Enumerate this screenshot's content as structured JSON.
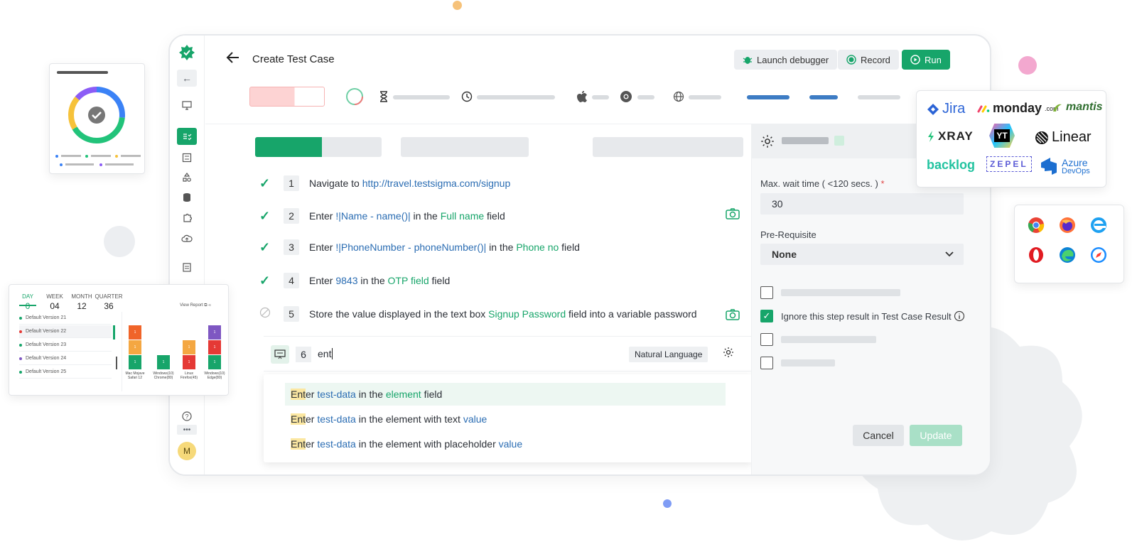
{
  "header": {
    "title": "Create Test Case",
    "launch_debugger": "Launch debugger",
    "record": "Record",
    "run": "Run"
  },
  "steps": [
    {
      "num": "1",
      "parts": [
        {
          "t": "Navigate to ",
          "c": ""
        },
        {
          "t": "http://travel.testsigma.com/signup",
          "c": "blue"
        }
      ]
    },
    {
      "num": "2",
      "parts": [
        {
          "t": "Enter ",
          "c": ""
        },
        {
          "t": "!|Name - name()|",
          "c": "blue"
        },
        {
          "t": " in the ",
          "c": ""
        },
        {
          "t": "Full name",
          "c": "green"
        },
        {
          "t": " field",
          "c": ""
        }
      ]
    },
    {
      "num": "3",
      "parts": [
        {
          "t": "Enter ",
          "c": ""
        },
        {
          "t": "!|PhoneNumber - phoneNumber()|",
          "c": "blue"
        },
        {
          "t": " in the ",
          "c": ""
        },
        {
          "t": "Phone no",
          "c": "green"
        },
        {
          "t": " field",
          "c": ""
        }
      ]
    },
    {
      "num": "4",
      "parts": [
        {
          "t": "Enter ",
          "c": ""
        },
        {
          "t": "9843",
          "c": "blue"
        },
        {
          "t": " in the ",
          "c": ""
        },
        {
          "t": "OTP field",
          "c": "green"
        },
        {
          "t": " field",
          "c": ""
        }
      ]
    },
    {
      "num": "5",
      "parts": [
        {
          "t": "Store the value displayed in the text box ",
          "c": ""
        },
        {
          "t": "Signup Password",
          "c": "green"
        },
        {
          "t": " field into a variable password",
          "c": ""
        }
      ]
    }
  ],
  "editor": {
    "num": "6",
    "typed": "ent",
    "mode": "Natural Language"
  },
  "suggestions": [
    {
      "parts": [
        {
          "t": "Ent",
          "c": "hl"
        },
        {
          "t": "er ",
          "c": ""
        },
        {
          "t": "test-data",
          "c": "blue"
        },
        {
          "t": " in the ",
          "c": ""
        },
        {
          "t": "element",
          "c": "green"
        },
        {
          "t": " field",
          "c": ""
        }
      ]
    },
    {
      "parts": [
        {
          "t": "Ent",
          "c": "hl"
        },
        {
          "t": "er ",
          "c": ""
        },
        {
          "t": "test-data",
          "c": "blue"
        },
        {
          "t": " in the element with text ",
          "c": ""
        },
        {
          "t": "value",
          "c": "blue"
        }
      ]
    },
    {
      "parts": [
        {
          "t": "Ent",
          "c": "hl"
        },
        {
          "t": "er ",
          "c": ""
        },
        {
          "t": "test-data",
          "c": "blue"
        },
        {
          "t": " in the element with placeholder ",
          "c": ""
        },
        {
          "t": "value",
          "c": "blue"
        }
      ]
    }
  ],
  "panel": {
    "max_wait_label": "Max. wait time ( <120 secs. )",
    "required_mark": "*",
    "max_wait_value": "30",
    "prereq_label": "Pre-Requisite",
    "prereq_value": "None",
    "ignore_label": "Ignore this step result in Test Case Result",
    "cancel": "Cancel",
    "update": "Update"
  },
  "sidebar": {
    "avatar": "M"
  },
  "integrations": {
    "jira": "Jira",
    "monday": "monday",
    "monday_suffix": ".com",
    "mantis": "mantis",
    "xray": "XRAY",
    "yt": "YT",
    "linear": "Linear",
    "backlog": "backlog",
    "zepel": "ZEPEL",
    "azure1": "Azure",
    "azure2": "DevOps"
  },
  "report": {
    "tabs": [
      {
        "label": "DAY",
        "value": "0"
      },
      {
        "label": "WEEK",
        "value": "04"
      },
      {
        "label": "MONTH",
        "value": "12"
      },
      {
        "label": "QUARTER",
        "value": "36"
      }
    ],
    "view_report": "View Report",
    "versions": [
      "Default Version 21",
      "Default Version 22",
      "Default Version 23",
      "Default Version 24",
      "Default Version 25"
    ],
    "bar_labels": [
      "Mac Mojave\nSafari 12",
      "Windows(10)\nChrome(80)",
      "Linux\nFirefox(45)",
      "Windows(10)\nEdge(80)"
    ],
    "seg_value": "1"
  },
  "colors": {
    "brand_green": "#17a56a",
    "link_blue": "#2b6db3",
    "highlight": "#fbe7a1"
  }
}
